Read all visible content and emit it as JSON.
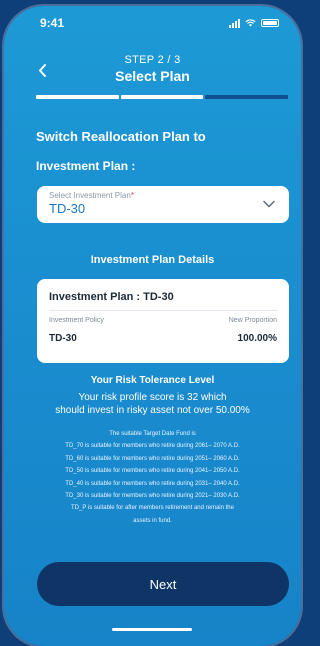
{
  "status_bar": {
    "time": "9:41"
  },
  "header": {
    "step": "STEP 2 / 3",
    "title": "Select Plan"
  },
  "progress": {
    "current_step": 2,
    "total_steps": 3
  },
  "section_title": "Switch Reallocation Plan to",
  "plan_label": "Investment Plan :",
  "select": {
    "placeholder": "Select Investment Plan",
    "required_mark": "*",
    "value": "TD-30"
  },
  "details": {
    "title": "Investment Plan Details",
    "card_title": "Investment Plan : TD-30",
    "col_policy": "Investment Policy",
    "col_proportion": "New Proportion",
    "policy_value": "TD-30",
    "proportion_value": "100.00%"
  },
  "risk": {
    "title": "Your Risk Tolerance Level",
    "line1": "Your risk profile score is 32 which",
    "line2": "should invest in risky asset not over 50.00%"
  },
  "fund_info": [
    "The suitable Target Date Fund is",
    "TD_70 is suitable for members who retire during 2061– 2070 A.D.",
    "TD_60 is suitable for members who retire during 2051– 2060 A.D.",
    "TD_50 is suitable for members who retire during 2041– 2050 A.D.",
    "TD_40 is suitable for members who retire during 2031– 2040 A.D.",
    "TD_30 is suitable for members who retire during 2021– 2030 A.D.",
    "TD_P is suitable for after members retirement and remain the",
    "assets in fund."
  ],
  "next_button": "Next",
  "colors": {
    "primary": "#1a8fd0",
    "button": "#0e3566",
    "accent_text": "#1a77c2"
  }
}
